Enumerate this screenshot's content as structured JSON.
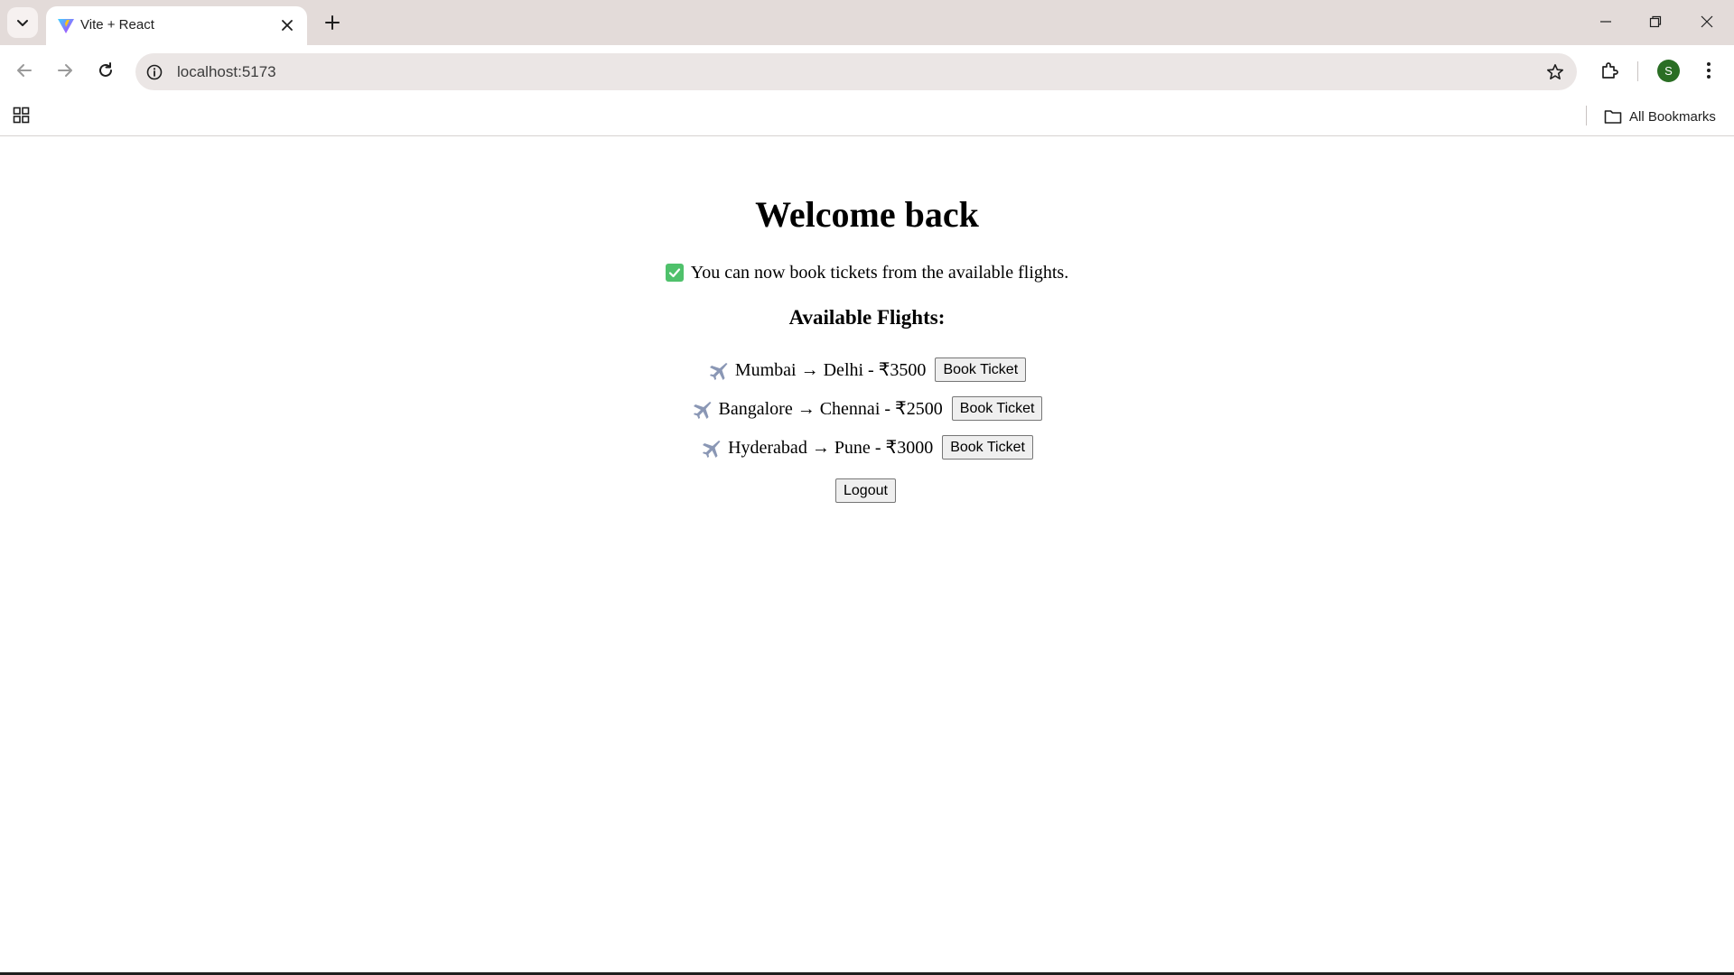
{
  "browser": {
    "tab": {
      "title": "Vite + React",
      "favicon": "vite-logo-icon"
    },
    "address_bar": {
      "url": "localhost:5173"
    },
    "profile_initial": "S",
    "bookmarks_bar": {
      "all_bookmarks_label": "All Bookmarks"
    },
    "colors": {
      "tabstrip": "#e3dbd9",
      "omnibox": "#ebe6e5",
      "avatar": "#2a6e24"
    }
  },
  "page": {
    "title": "Welcome back",
    "notice": "You can now book tickets from the available flights.",
    "notice_icon": "check-mark-button-icon",
    "flights_heading": "Available Flights:",
    "flights": [
      {
        "route": "Mumbai → Delhi - ₹3500",
        "button_label": "Book Ticket"
      },
      {
        "route": "Bangalore → Chennai - ₹2500",
        "button_label": "Book Ticket"
      },
      {
        "route": "Hyderabad → Pune - ₹3000",
        "button_label": "Book Ticket"
      }
    ],
    "logout_label": "Logout"
  }
}
